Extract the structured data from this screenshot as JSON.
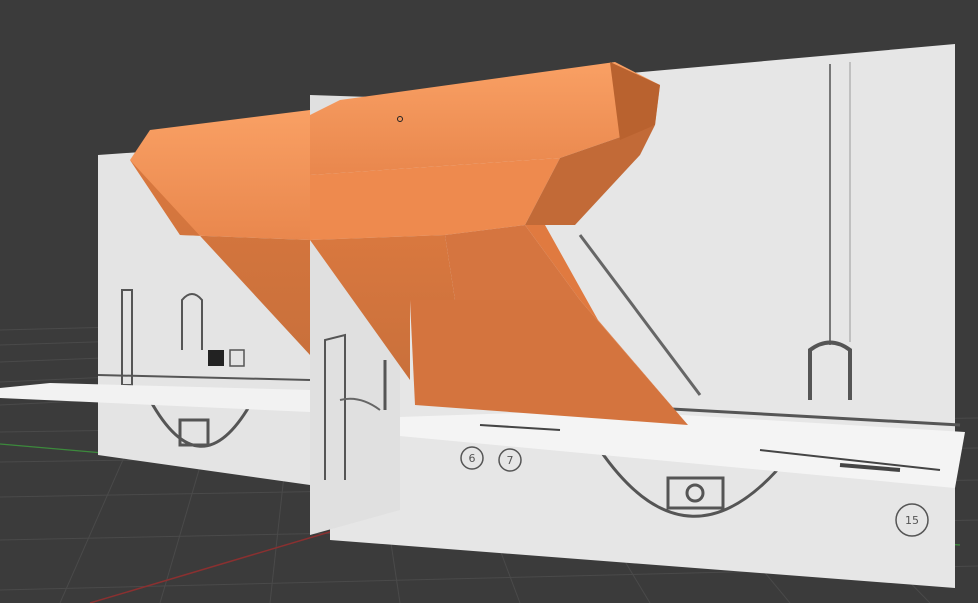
{
  "viewport": {
    "mode": "3d-perspective",
    "background_color": "#3b3b3b",
    "grid_color": "#4a4a4a",
    "x_axis_color": "#8a3030",
    "y_axis_color": "#3c8a3c"
  },
  "scene": {
    "model_color": "#f08c50",
    "blueprint_color": "#e8e8e8",
    "blueprint_line_color": "#555555",
    "callouts": [
      "6",
      "7",
      "15"
    ]
  }
}
